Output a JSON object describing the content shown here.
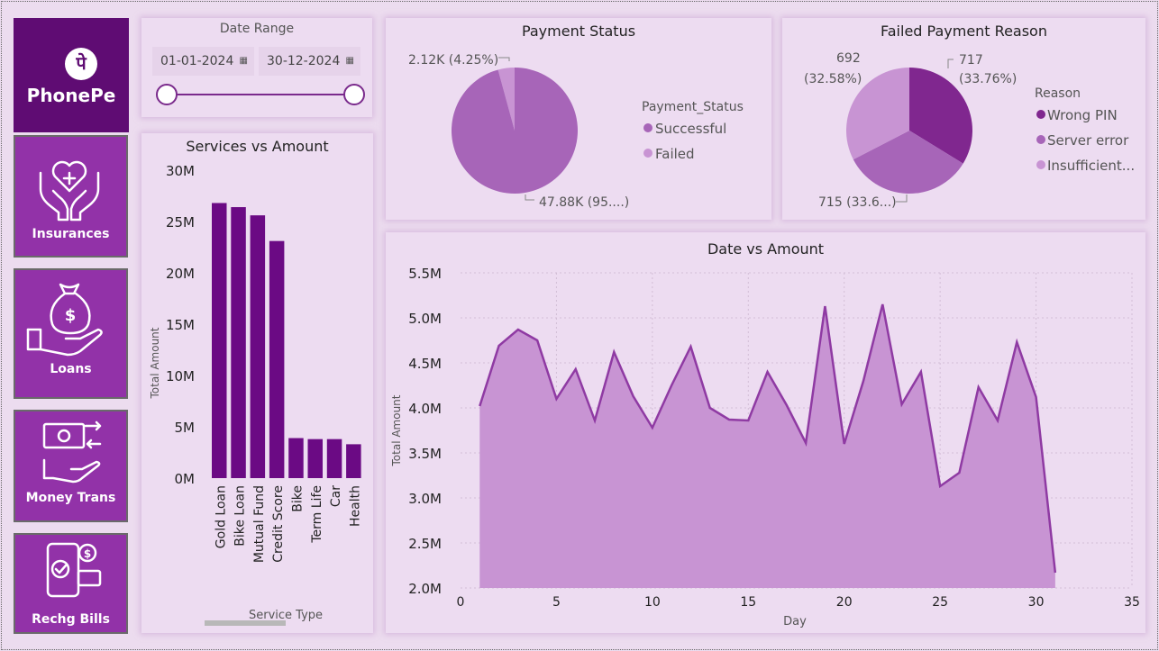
{
  "brand": {
    "name": "PhonePe",
    "logo_glyph": "पे"
  },
  "nav": [
    {
      "label": "Insurances",
      "icon": "heart-hands-icon"
    },
    {
      "label": "Loans",
      "icon": "money-bag-hand-icon"
    },
    {
      "label": "Money Trans",
      "icon": "money-transfer-icon"
    },
    {
      "label": "Rechg Bills",
      "icon": "mobile-bill-icon"
    }
  ],
  "date_range": {
    "title": "Date Range",
    "start": "01-01-2024",
    "end": "30-12-2024"
  },
  "payment_status": {
    "title": "Payment Status",
    "legend_title": "Payment_Status",
    "legend": [
      "Successful",
      "Failed"
    ],
    "label_failed": "2.12K (4.25%)",
    "label_successful": "47.88K (95....)"
  },
  "failed_reason": {
    "title": "Failed Payment Reason",
    "legend_title": "Reason",
    "legend": [
      "Wrong PIN",
      "Server error",
      "Insufficient..."
    ],
    "label_wrong_pin": [
      "717",
      "(33.76%)"
    ],
    "label_insufficient": [
      "692",
      "(32.58%)"
    ],
    "label_server": "715 (33.6...)"
  },
  "services_chart": {
    "title": "Services vs Amount",
    "ylabel": "Total Amount",
    "xlabel": "Service Type",
    "yticks": [
      "30M",
      "25M",
      "20M",
      "15M",
      "10M",
      "5M",
      "0M"
    ]
  },
  "date_chart": {
    "title": "Date vs Amount",
    "ylabel": "Total Amount",
    "xlabel": "Day",
    "yticks": [
      "5.5M",
      "5.0M",
      "4.5M",
      "4.0M",
      "3.5M",
      "3.0M",
      "2.5M",
      "2.0M"
    ],
    "xticks": [
      "0",
      "5",
      "10",
      "15",
      "20",
      "25",
      "30",
      "35"
    ]
  },
  "colors": {
    "dark": "#6b0a84",
    "mid": "#a765b8",
    "light": "#c894d3",
    "nav": "#9232a8",
    "brand_bg": "#5f0c73"
  },
  "chart_data": [
    {
      "type": "pie",
      "title": "Payment Status",
      "categories": [
        "Successful",
        "Failed"
      ],
      "values": [
        47880,
        2120
      ]
    },
    {
      "type": "pie",
      "title": "Failed Payment Reason",
      "categories": [
        "Wrong PIN",
        "Server error",
        "Insufficient..."
      ],
      "values": [
        717,
        715,
        692
      ]
    },
    {
      "type": "bar",
      "title": "Services vs Amount",
      "xlabel": "Service Type",
      "ylabel": "Total Amount",
      "categories": [
        "Gold Loan",
        "Bike Loan",
        "Mutual Fund",
        "Credit Score",
        "Bike",
        "Term Life",
        "Car",
        "Health"
      ],
      "values": [
        26800000,
        26400000,
        25600000,
        23100000,
        3900000,
        3800000,
        3800000,
        3300000
      ],
      "ylim": [
        0,
        30000000
      ]
    },
    {
      "type": "area",
      "title": "Date vs Amount",
      "xlabel": "Day",
      "ylabel": "Total Amount",
      "x": [
        1,
        2,
        3,
        4,
        5,
        6,
        7,
        8,
        9,
        10,
        11,
        12,
        13,
        14,
        15,
        16,
        17,
        18,
        19,
        20,
        21,
        22,
        23,
        24,
        25,
        26,
        27,
        28,
        29,
        30,
        31
      ],
      "values": [
        4020000,
        4690000,
        4870000,
        4750000,
        4100000,
        4430000,
        3860000,
        4620000,
        4130000,
        3780000,
        4250000,
        4680000,
        4000000,
        3870000,
        3860000,
        4400000,
        4030000,
        3610000,
        5130000,
        3600000,
        4300000,
        5150000,
        4040000,
        4400000,
        3130000,
        3280000,
        4230000,
        3860000,
        4730000,
        4120000,
        2170000
      ],
      "xlim": [
        0,
        35
      ],
      "ylim": [
        2000000,
        5500000
      ],
      "grid": true
    }
  ]
}
